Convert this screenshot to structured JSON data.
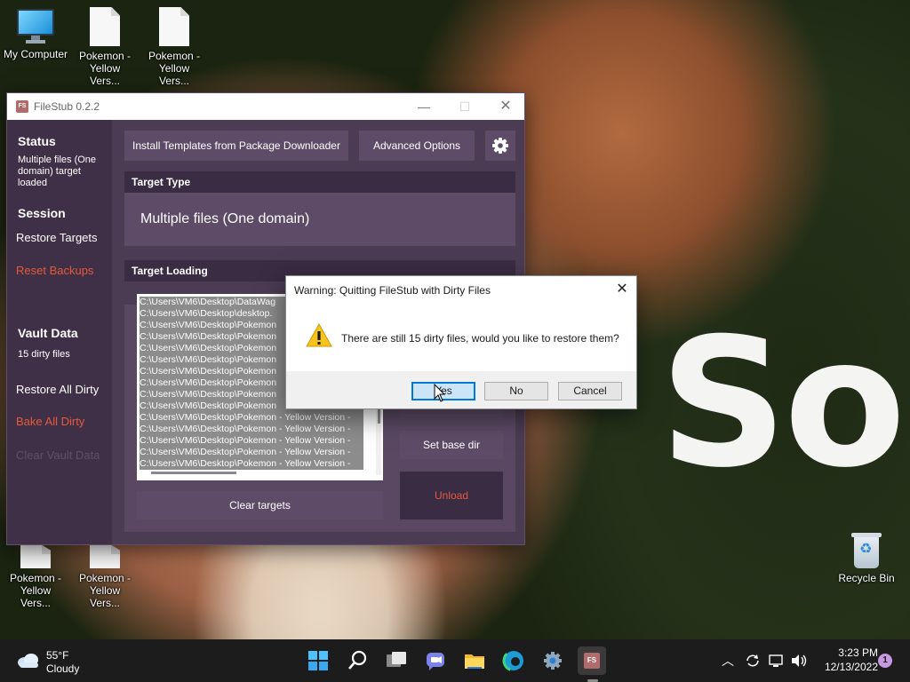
{
  "wallpaper": {
    "text": "Sos"
  },
  "desktop_icons": {
    "my_computer": "My Computer",
    "top_file_1": "Pokemon - Yellow Vers...",
    "top_file_2": "Pokemon - Yellow Vers...",
    "bottom_file_1": "Pokemon - Yellow Vers...",
    "bottom_file_2": "Pokemon - Yellow Vers...",
    "recycle_bin": "Recycle Bin"
  },
  "filestub": {
    "app_icon_text": "FS",
    "title": "FileStub 0.2.2",
    "sidebar": {
      "status_heading": "Status",
      "status_text": "Multiple files (One domain) target loaded",
      "session_heading": "Session",
      "restore_targets": "Restore Targets",
      "reset_backups": "Reset Backups",
      "vault_heading": "Vault Data",
      "vault_text": "15 dirty files",
      "restore_all_dirty": "Restore All Dirty",
      "bake_all_dirty": "Bake All Dirty",
      "clear_vault_data": "Clear Vault Data"
    },
    "toolbar": {
      "install_templates": "Install Templates from Package Downloader",
      "advanced_options": "Advanced Options"
    },
    "target_type": {
      "heading": "Target Type",
      "value": "Multiple files (One domain)"
    },
    "target_loading": {
      "heading": "Target Loading",
      "targets": [
        "C:\\Users\\VM6\\Desktop\\DataWag",
        "C:\\Users\\VM6\\Desktop\\desktop.",
        "C:\\Users\\VM6\\Desktop\\Pokemon",
        "C:\\Users\\VM6\\Desktop\\Pokemon",
        "C:\\Users\\VM6\\Desktop\\Pokemon",
        "C:\\Users\\VM6\\Desktop\\Pokemon",
        "C:\\Users\\VM6\\Desktop\\Pokemon",
        "C:\\Users\\VM6\\Desktop\\Pokemon",
        "C:\\Users\\VM6\\Desktop\\Pokemon",
        "C:\\Users\\VM6\\Desktop\\Pokemon",
        "C:\\Users\\VM6\\Desktop\\Pokemon - Yellow Version -",
        "C:\\Users\\VM6\\Desktop\\Pokemon - Yellow Version -",
        "C:\\Users\\VM6\\Desktop\\Pokemon - Yellow Version -",
        "C:\\Users\\VM6\\Desktop\\Pokemon - Yellow Version -",
        "C:\\Users\\VM6\\Desktop\\Pokemon - Yellow Version -"
      ],
      "clear_targets": "Clear targets",
      "set_base_dir": "Set base dir",
      "unload": "Unload"
    }
  },
  "dialog": {
    "title": "Warning: Quitting FileStub with Dirty Files",
    "message": "There are still 15 dirty files, would you like to restore them?",
    "yes": "Yes",
    "no": "No",
    "cancel": "Cancel"
  },
  "taskbar": {
    "weather_temp": "55°F",
    "weather_desc": "Cloudy",
    "time": "3:23 PM",
    "date": "12/13/2022",
    "notification_count": "1",
    "filestub_label": "FS"
  },
  "colors": {
    "accent_red": "#e45a3a",
    "window_bg": "#4b3b53",
    "sidebar_bg": "#3f3047",
    "dialog_default_button": "#cce4f7"
  }
}
